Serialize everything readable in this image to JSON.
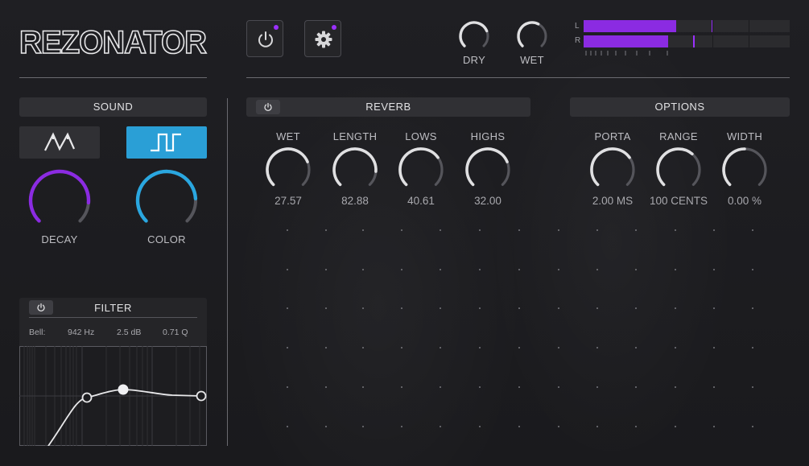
{
  "app": {
    "logo": "REZONATOR"
  },
  "header": {
    "power_button": {
      "icon": "power-icon",
      "indicator_color": "#9b30ff"
    },
    "settings_button": {
      "icon": "gear-icon",
      "indicator_color": "#9b30ff"
    },
    "dry_label": "DRY",
    "wet_label": "WET",
    "dry_level": 0.75,
    "wet_level": 0.6,
    "meter": {
      "channels": [
        {
          "label": "L",
          "level": 0.45,
          "peak": 0.62
        },
        {
          "label": "R",
          "level": 0.41,
          "peak": 0.53
        }
      ]
    }
  },
  "sound": {
    "title": "SOUND",
    "waveforms": [
      {
        "icon": "sawtooth-wave-icon",
        "selected": false
      },
      {
        "icon": "square-wave-icon",
        "selected": true
      }
    ],
    "knobs": [
      {
        "label": "DECAY",
        "level": 0.85,
        "color": "#8b2be2"
      },
      {
        "label": "COLOR",
        "level": 0.82,
        "color": "#2aa7e0"
      }
    ]
  },
  "filter": {
    "title": "FILTER",
    "type": "Bell:",
    "freq": "942 Hz",
    "gain": "2.5 dB",
    "q": "0.71 Q"
  },
  "reverb": {
    "title": "REVERB",
    "knobs": [
      {
        "label": "WET",
        "value": "27.57",
        "level": 0.75
      },
      {
        "label": "LENGTH",
        "value": "82.88",
        "level": 0.85
      },
      {
        "label": "LOWS",
        "value": "40.61",
        "level": 0.7
      },
      {
        "label": "HIGHS",
        "value": "32.00",
        "level": 0.75
      }
    ]
  },
  "options": {
    "title": "OPTIONS",
    "knobs": [
      {
        "label": "PORTA",
        "value": "2.00 MS",
        "level": 0.7
      },
      {
        "label": "RANGE",
        "value": "100 CENTS",
        "level": 0.65
      },
      {
        "label": "WIDTH",
        "value": "0.00 %",
        "level": 0.5
      }
    ]
  },
  "colors": {
    "accent_purple": "#8b2be2",
    "accent_blue": "#2aa7e0",
    "panel": "#303034"
  }
}
